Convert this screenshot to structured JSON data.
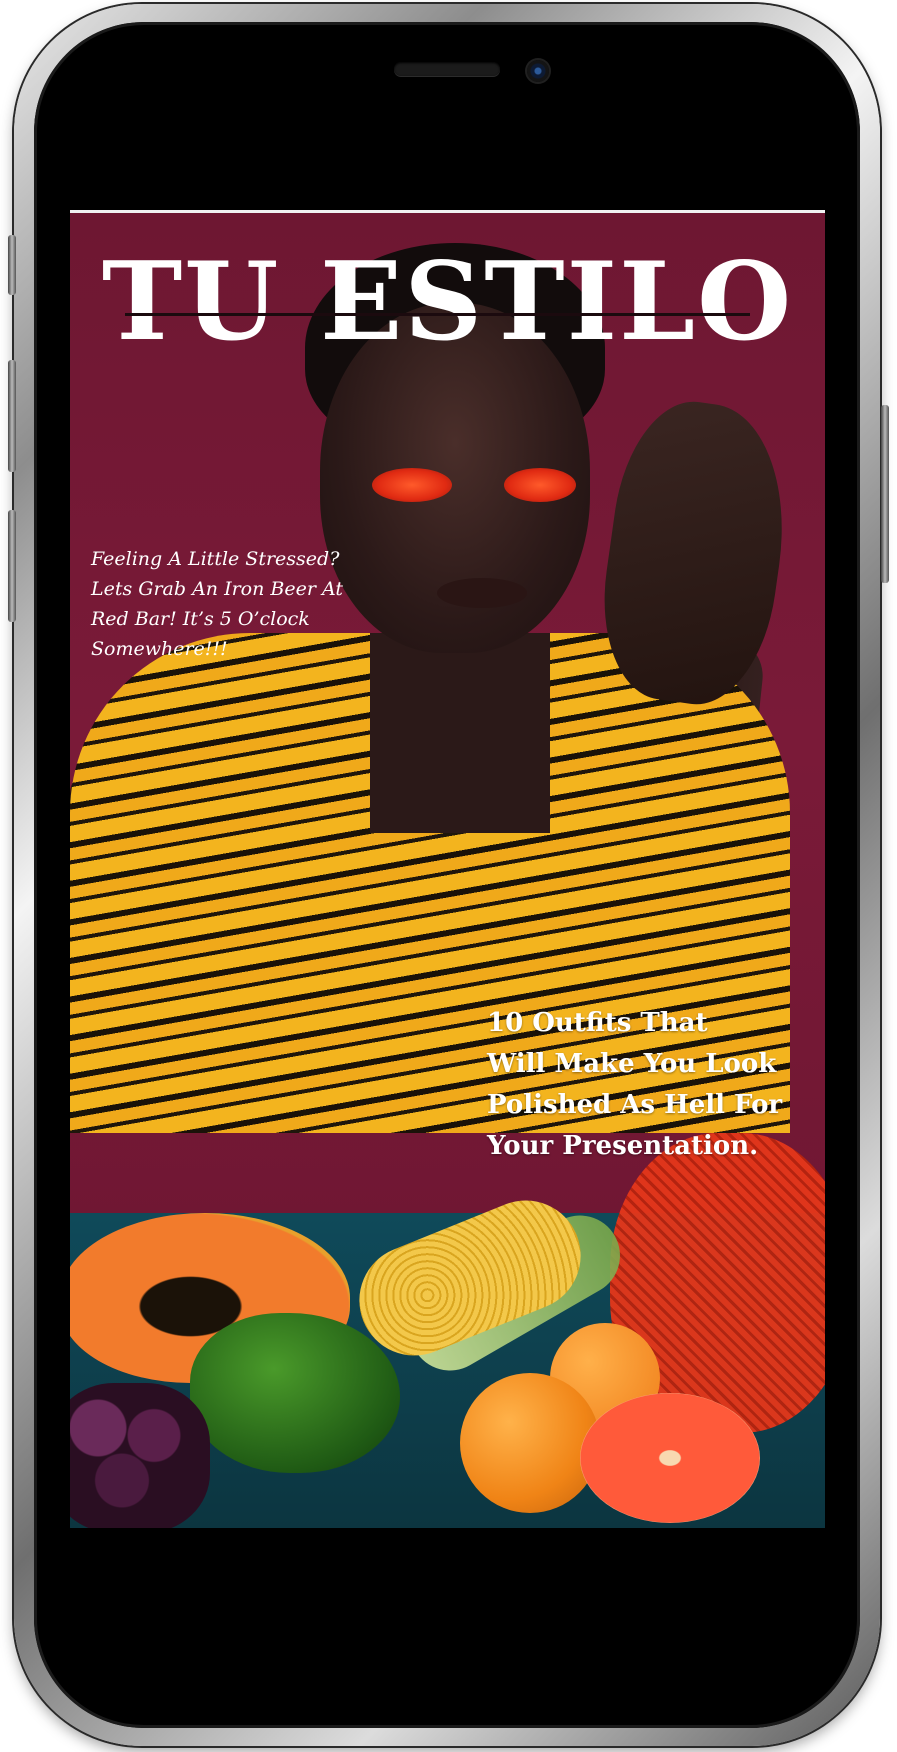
{
  "magazine": {
    "title": "TU ESTILO",
    "tagline": "Feeling A Little Stressed? Lets Grab An Iron Beer At Red Bar! It’s 5 O’clock Somewhere!!!",
    "headline": "10  Outfits That\nWill Make You Look\n Polished As Hell For\nYour Presentation."
  },
  "colors": {
    "background": "#7a1a38",
    "title_text": "#ffffff",
    "shirt": "#f2b21f"
  }
}
